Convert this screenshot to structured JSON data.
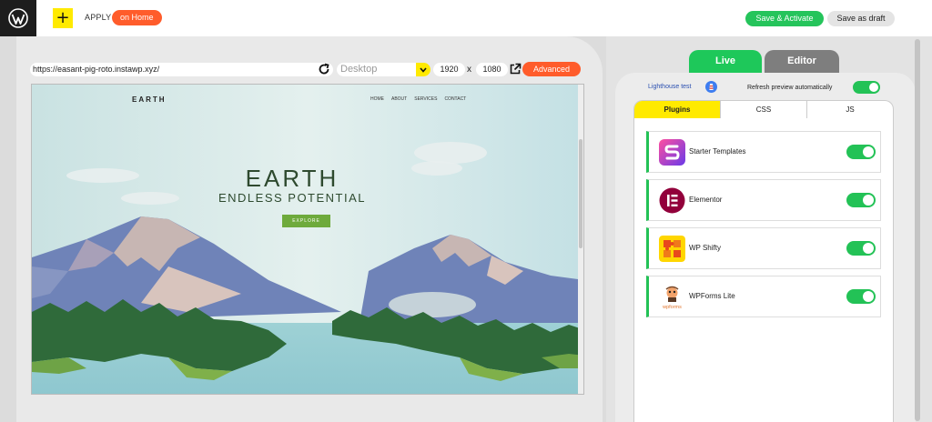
{
  "topbar": {
    "apply_label": "APPLY",
    "on_home_label": "on Home",
    "plus_label": "+",
    "save_activate_label": "Save & Activate",
    "save_draft_label": "Save as draft"
  },
  "preview_toolbar": {
    "url": "https://easant-pig-roto.instawp.xyz/",
    "device_placeholder": "Desktop",
    "width": "1920",
    "height": "1080",
    "times": "x",
    "advanced_label": "Advanced"
  },
  "site": {
    "brand": "EARTH",
    "nav": [
      "HOME",
      "ABOUT",
      "SERVICES",
      "CONTACT"
    ],
    "hero_title": "EARTH",
    "hero_subtitle": "ENDLESS POTENTIAL",
    "hero_button": "EXPLORE"
  },
  "panel": {
    "tabs": {
      "live": "Live",
      "editor": "Editor"
    },
    "lighthouse_label": "Lighthouse test",
    "refresh_label": "Refresh preview automatically",
    "refresh_enabled": true,
    "sub_tabs": [
      "Plugins",
      "CSS",
      "JS"
    ],
    "active_sub_tab": "Plugins",
    "plugins": [
      {
        "name": "Starter Templates",
        "icon": "starter-templates-icon",
        "enabled": true
      },
      {
        "name": "Elementor",
        "icon": "elementor-icon",
        "enabled": true
      },
      {
        "name": "WP Shifty",
        "icon": "wp-shifty-icon",
        "enabled": true
      },
      {
        "name": "WPForms Lite",
        "icon": "wpforms-icon",
        "icon_text": "wpforms",
        "enabled": true
      }
    ]
  },
  "colors": {
    "accent_green": "#23c256",
    "accent_orange": "#ff5c2b",
    "accent_yellow": "#ffea00"
  }
}
